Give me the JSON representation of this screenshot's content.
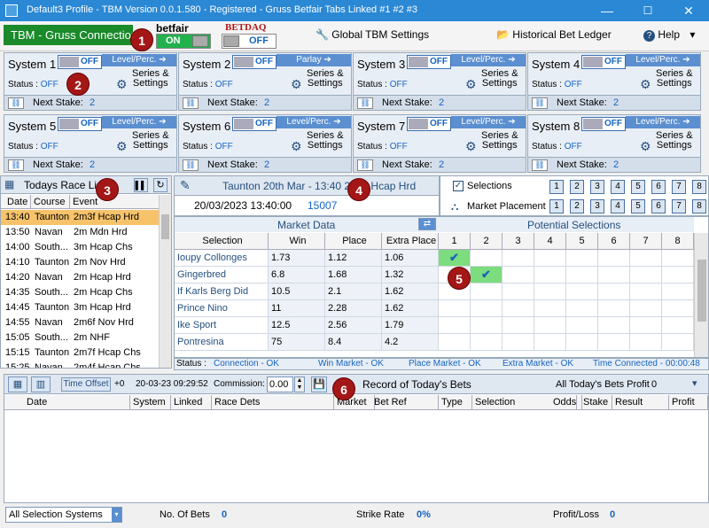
{
  "window": {
    "title": "Default3 Profile  -  TBM Version 0.0.1.580 - Registered - Gruss Betfair Tabs Linked #1 #2 #3",
    "minimize": "—",
    "maximize": "☐",
    "close": "✕"
  },
  "toolbar": {
    "connection": "TBM - Gruss Connection",
    "betfair_logo": "betfair",
    "betfair_toggle": "ON",
    "betdaq_logo": "BETDAQ",
    "betdaq_toggle": "OFF",
    "global_settings": "Global TBM Settings",
    "bet_ledger": "Historical Bet Ledger",
    "help": "Help",
    "help_arrow": "▾"
  },
  "systems": [
    {
      "name": "System 1",
      "toggle": "OFF",
      "mode": "Level/Perc.",
      "status_label": "Status :",
      "status": "OFF",
      "settings": "Series &\nSettings",
      "next_label": "Next Stake:",
      "next": "2"
    },
    {
      "name": "System 2",
      "toggle": "OFF",
      "mode": "Parlay",
      "status_label": "Status :",
      "status": "OFF",
      "settings": "Series &\nSettings",
      "next_label": "Next Stake:",
      "next": "2"
    },
    {
      "name": "System 3",
      "toggle": "OFF",
      "mode": "Level/Perc.",
      "status_label": "Status :",
      "status": "OFF",
      "settings": "Series &\nSettings",
      "next_label": "Next Stake:",
      "next": "2"
    },
    {
      "name": "System 4",
      "toggle": "OFF",
      "mode": "Level/Perc.",
      "status_label": "Status :",
      "status": "OFF",
      "settings": "Series &\nSettings",
      "next_label": "Next Stake:",
      "next": "2"
    },
    {
      "name": "System 5",
      "toggle": "OFF",
      "mode": "Level/Perc.",
      "status_label": "Status :",
      "status": "OFF",
      "settings": "Series &\nSettings",
      "next_label": "Next Stake:",
      "next": "2"
    },
    {
      "name": "System 6",
      "toggle": "OFF",
      "mode": "Level/Perc.",
      "status_label": "Status :",
      "status": "OFF",
      "settings": "Series &\nSettings",
      "next_label": "Next Stake:",
      "next": "2"
    },
    {
      "name": "System 7",
      "toggle": "OFF",
      "mode": "Level/Perc.",
      "status_label": "Status :",
      "status": "OFF",
      "settings": "Series &\nSettings",
      "next_label": "Next Stake:",
      "next": "2"
    },
    {
      "name": "System 8",
      "toggle": "OFF",
      "mode": "Level/Perc.",
      "status_label": "Status :",
      "status": "OFF",
      "settings": "Series &\nSettings",
      "next_label": "Next Stake:",
      "next": "2"
    }
  ],
  "race_list": {
    "title": "Todays Race List",
    "columns": [
      "Date",
      "Course",
      "Event"
    ],
    "rows": [
      {
        "time": "13:40",
        "course": "Taunton",
        "event": "2m3f Hcap Hrd",
        "selected": true
      },
      {
        "time": "13:50",
        "course": "Navan",
        "event": "2m Mdn Hrd"
      },
      {
        "time": "14:00",
        "course": "South...",
        "event": "3m Hcap Chs"
      },
      {
        "time": "14:10",
        "course": "Taunton",
        "event": "2m Nov Hrd"
      },
      {
        "time": "14:20",
        "course": "Navan",
        "event": "2m Hcap Hrd"
      },
      {
        "time": "14:35",
        "course": "South...",
        "event": "2m Hcap Chs"
      },
      {
        "time": "14:45",
        "course": "Taunton",
        "event": "3m Hcap Hrd"
      },
      {
        "time": "14:55",
        "course": "Navan",
        "event": "2m6f Nov Hrd"
      },
      {
        "time": "15:05",
        "course": "South...",
        "event": "2m NHF"
      },
      {
        "time": "15:15",
        "course": "Taunton",
        "event": "2m7f Hcap Chs"
      },
      {
        "time": "15:25",
        "course": "Navan",
        "event": "2m4f Hcap Chs"
      }
    ]
  },
  "market": {
    "race_title": "Taunton 20th Mar - 13:40 2m3f Hcap Hrd",
    "datetime": "20/03/2023 13:40:00",
    "market_id": "15007",
    "selections_label": "Selections",
    "placement_label": "Market Placement",
    "buttons": [
      "1",
      "2",
      "3",
      "4",
      "5",
      "6",
      "7",
      "8"
    ],
    "market_data_label": "Market Data",
    "potential_label": "Potential Selections",
    "columns": [
      "Selection",
      "Win",
      "Place",
      "Extra Place"
    ],
    "ps_columns": [
      "1",
      "2",
      "3",
      "4",
      "5",
      "6",
      "7",
      "8"
    ],
    "rows": [
      {
        "name": "Ioupy Collonges",
        "win": "1.73",
        "place": "1.12",
        "extra": "1.06",
        "check": 0
      },
      {
        "name": "Gingerbred",
        "win": "6.8",
        "place": "1.68",
        "extra": "1.32",
        "check": 1
      },
      {
        "name": "If Karls Berg Did",
        "win": "10.5",
        "place": "2.1",
        "extra": "1.62",
        "check": -1
      },
      {
        "name": "Prince Nino",
        "win": "11",
        "place": "2.28",
        "extra": "1.62",
        "check": -1
      },
      {
        "name": "Ike Sport",
        "win": "12.5",
        "place": "2.56",
        "extra": "1.79",
        "check": -1
      },
      {
        "name": "Pontresina",
        "win": "75",
        "place": "8.4",
        "extra": "4.2",
        "check": -1
      }
    ],
    "status_items": [
      "Status :",
      "Connection - OK",
      "Win Market - OK",
      "Place Market - OK",
      "Extra Market - OK",
      "Time Connected - 00:00:48"
    ]
  },
  "bets": {
    "time_offset_btn": "Time Offset",
    "offset": "+0",
    "clock": "20-03-23 09:29:52",
    "commission_label": "Commission:",
    "commission": "0.00",
    "title": "Record of Today's Bets",
    "profit_label": "All Today's Bets Profit",
    "profit": "0",
    "columns": [
      "Date",
      "System",
      "Linked",
      "Race Dets",
      "Market",
      "Bet Ref",
      "Type",
      "Selection",
      "Odds",
      "Stake",
      "Result",
      "Profit"
    ]
  },
  "footer": {
    "filter": "All Selection Systems",
    "no_bets_label": "No. Of Bets",
    "no_bets": "0",
    "strike_label": "Strike Rate",
    "strike": "0%",
    "pl_label": "Profit/Loss",
    "pl": "0"
  },
  "callouts": [
    "1",
    "2",
    "3",
    "4",
    "5",
    "6"
  ],
  "colors": {
    "accent": "#1565c0",
    "selected_row": "#f7c36a",
    "check_bg": "#7ddc7d",
    "callout": "#a41717"
  }
}
